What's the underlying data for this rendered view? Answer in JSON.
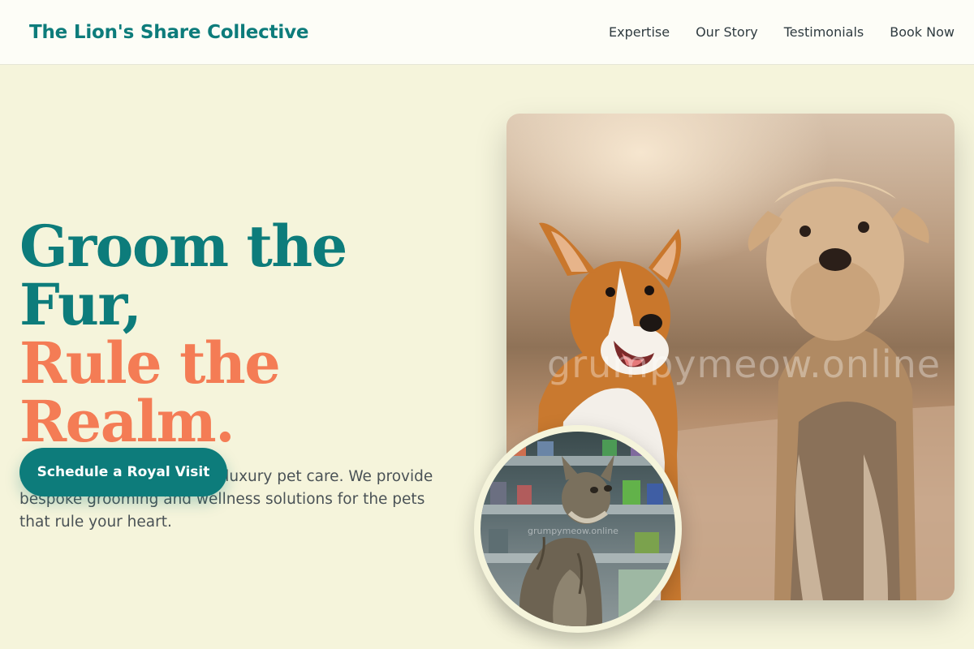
{
  "header": {
    "brand": "The Lion's Share Collective",
    "nav": [
      "Expertise",
      "Our Story",
      "Testimonials",
      "Book Now"
    ]
  },
  "hero": {
    "headline_line1": "Groom the Fur,",
    "headline_line2": "Rule the Realm.",
    "subtitle": "Experience the pinnacle of luxury pet care. We provide bespoke grooming and wellness solutions for the pets that rule your heart.",
    "cta_label": "Schedule a Royal Visit",
    "main_image_alt": "Corgi and Yorkshire terrier on a path",
    "main_image_watermark": "grumpymeow.online",
    "inset_image_alt": "Tabby cat looking up in a shop",
    "inset_image_watermark": "grumpymeow.online"
  },
  "colors": {
    "background": "#f5f4db",
    "header_bg": "#fdfdf7",
    "brand_teal": "#0d7c7b",
    "accent_coral": "#f47c55",
    "body_text": "#4a5256"
  }
}
